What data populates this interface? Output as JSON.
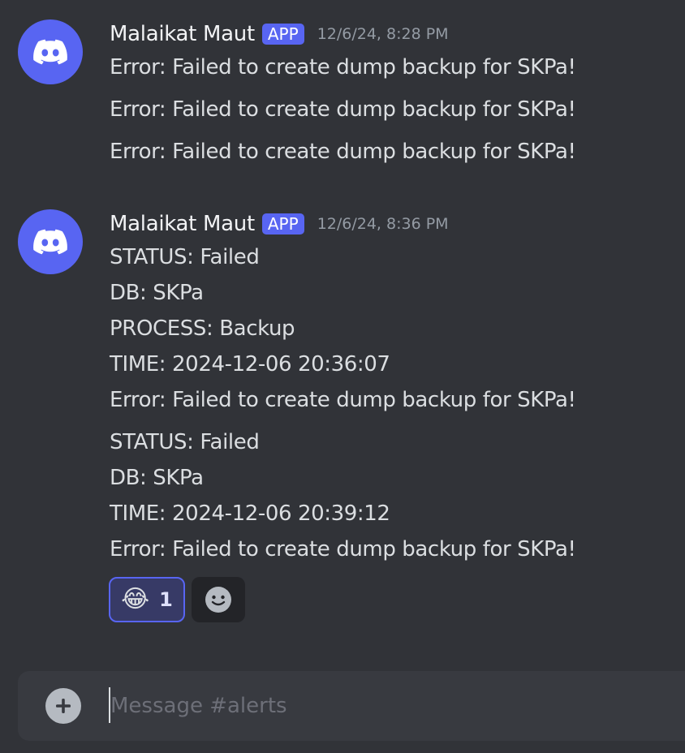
{
  "messages": [
    {
      "author": "Malaikat Maut",
      "badge": "APP",
      "timestamp": "12/6/24, 8:28 PM",
      "avatar_icon": "discord-logo-icon",
      "lines": [
        "Error: Failed to create dump backup for SKPa!",
        "Error: Failed to create dump backup for SKPa!",
        "Error: Failed to create dump backup for SKPa!"
      ]
    },
    {
      "author": "Malaikat Maut",
      "badge": "APP",
      "timestamp": "12/6/24, 8:36 PM",
      "avatar_icon": "discord-logo-icon",
      "lines": [
        "STATUS: Failed",
        "DB: SKPa",
        "PROCESS: Backup",
        "TIME: 2024-12-06 20:36:07",
        "Error: Failed to create dump backup for SKPa!",
        "STATUS: Failed",
        "DB: SKPa",
        "TIME: 2024-12-06 20:39:12",
        "Error: Failed to create dump backup for SKPa!"
      ],
      "reactions": [
        {
          "emoji": "😂",
          "count": "1",
          "selected": true
        }
      ],
      "add_reaction_icon": "add-reaction-smiley-icon"
    }
  ],
  "composer": {
    "placeholder": "Message #alerts",
    "attach_icon": "plus-circle-icon"
  },
  "colors": {
    "background": "#313338",
    "brand": "#5865f2",
    "composer": "#383a40",
    "timestamp": "#949ba4"
  }
}
